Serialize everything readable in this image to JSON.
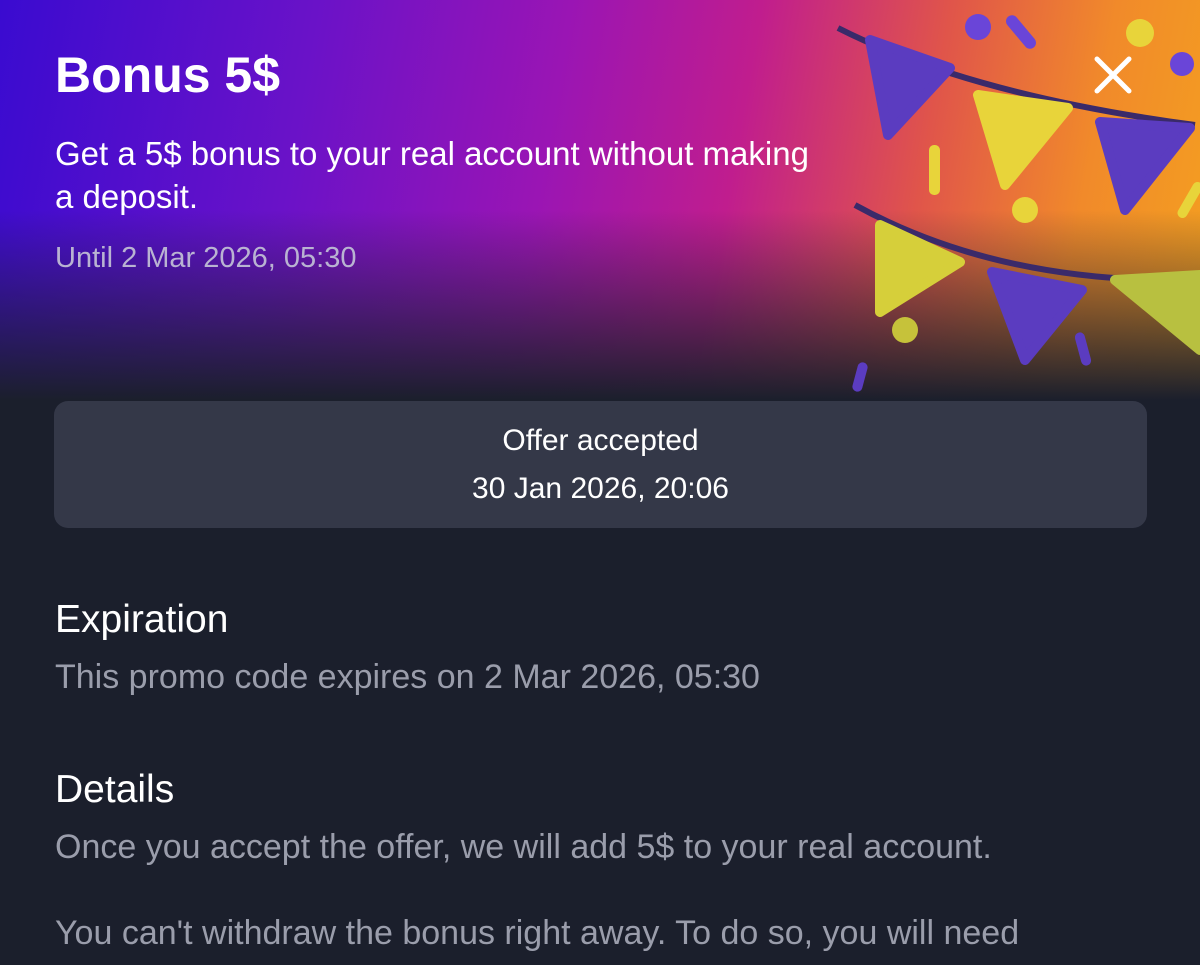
{
  "header": {
    "title": "Bonus 5$",
    "subtitle": "Get a 5$ bonus to your real account without making a deposit.",
    "until": "Until 2 Mar 2026, 05:30"
  },
  "close_icon": "close-icon",
  "status": {
    "label": "Offer accepted",
    "date": "30 Jan 2026, 20:06"
  },
  "expiration": {
    "heading": "Expiration",
    "text": "This promo code expires on 2 Mar 2026, 05:30"
  },
  "details": {
    "heading": "Details",
    "text1": "Once you accept the offer, we will add 5$ to your real account.",
    "text2": "You can't withdraw the bonus right away. To do so, you will need"
  },
  "colors": {
    "background": "#1b1f2c",
    "card": "#343848",
    "muted_text": "#9a9dab",
    "gradient_start": "#3a0bd0",
    "gradient_mid": "#9a15b4",
    "gradient_end": "#f4a020"
  }
}
